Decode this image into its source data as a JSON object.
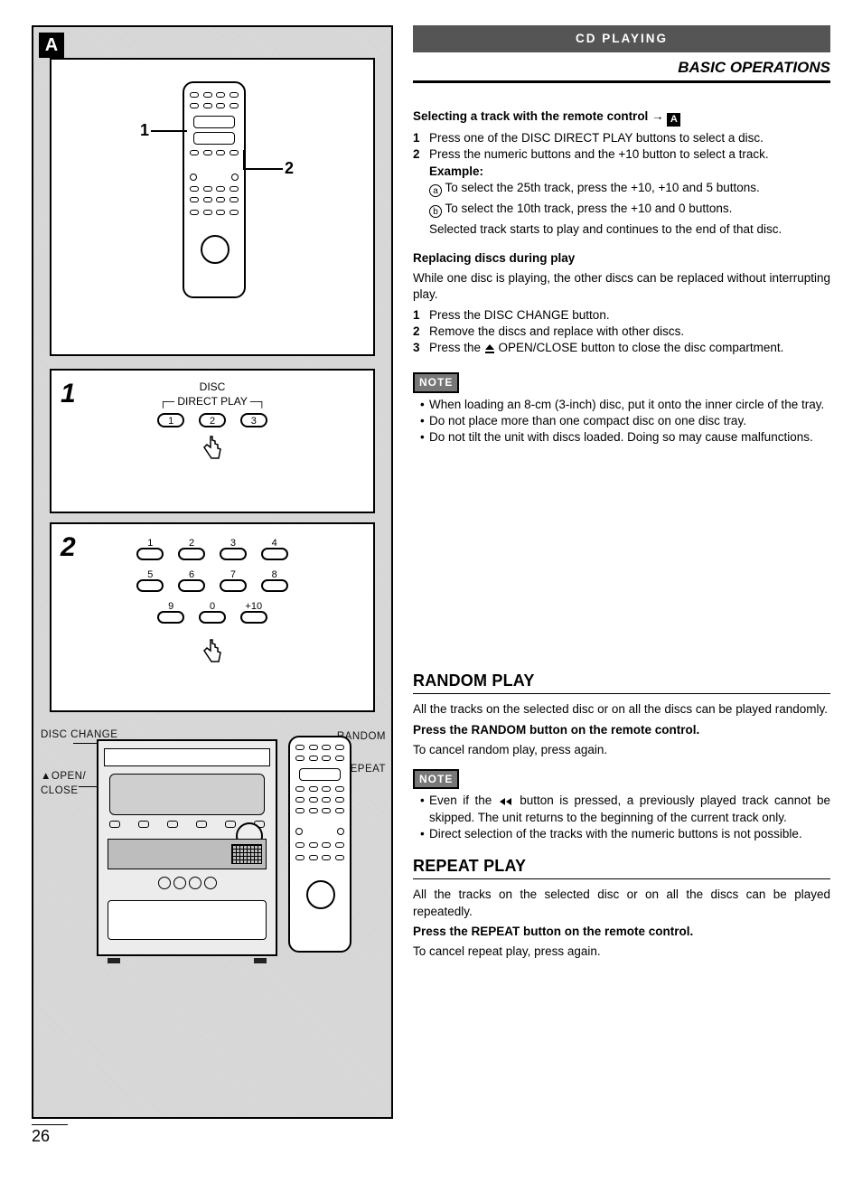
{
  "header": {
    "section": "CD PLAYING",
    "subsection": "BASIC OPERATIONS"
  },
  "figure": {
    "badge": "A",
    "panelA": {
      "callout1": "1",
      "callout2": "2"
    },
    "panel1": {
      "stepnum": "1",
      "caption_top": "DISC",
      "caption_bottom": "DIRECT PLAY",
      "buttons": [
        "1",
        "2",
        "3"
      ]
    },
    "panel2": {
      "stepnum": "2",
      "keys_row1": [
        "1",
        "2",
        "3",
        "4"
      ],
      "keys_row2": [
        "5",
        "6",
        "7",
        "8"
      ],
      "keys_row3": [
        "9",
        "0",
        "+10"
      ]
    },
    "panelB": {
      "labels": {
        "disc_change": "DISC CHANGE",
        "open_close_prefix": "▲OPEN/",
        "open_close_suffix": "CLOSE",
        "random": "RANDOM",
        "repeat": "REPEAT"
      }
    }
  },
  "right": {
    "s1": {
      "title": "Selecting a track with the remote control →",
      "ref": "A",
      "li1": "Press one of the DISC DIRECT PLAY buttons to select a disc.",
      "li2": "Press the numeric buttons and the +10 button to select a track.",
      "example_label": "Example:",
      "ex_a": "To select the 25th track, press the +10, +10 and 5 buttons.",
      "ex_b": "To select the 10th track, press the +10 and 0 buttons.",
      "after": "Selected track starts to play and continues to the end of that disc."
    },
    "s2": {
      "title": "Replacing discs during play",
      "intro": "While one disc is playing, the other discs can be replaced without interrupting play.",
      "li1": "Press the DISC CHANGE button.",
      "li2": "Remove the discs and replace with other discs.",
      "li3_a": "Press the ",
      "li3_b": " OPEN/CLOSE button to close the disc compartment."
    },
    "note1": {
      "label": "NOTE",
      "b1": "When loading an 8-cm (3-inch) disc, put it onto the inner circle of the tray.",
      "b2": "Do not place more than one compact disc on one disc tray.",
      "b3": "Do not tilt the unit with discs loaded.  Doing so may cause malfunctions."
    },
    "random": {
      "h": "RANDOM PLAY",
      "p1": "All the tracks on the selected disc or on all the discs can be played randomly.",
      "p2": "Press the RANDOM button on the remote control.",
      "p3": "To cancel random play, press again."
    },
    "note2": {
      "label": "NOTE",
      "b1a": "Even if the ",
      "b1b": " button is pressed, a previously played track cannot be skipped. The unit returns to the beginning of the current track only.",
      "b2": "Direct selection of the tracks with the numeric buttons is not possible."
    },
    "repeat": {
      "h": "REPEAT PLAY",
      "p1": "All the tracks on the selected disc or on all the discs can be played repeatedly.",
      "p2": "Press the REPEAT button on the remote control.",
      "p3": "To cancel repeat play, press again."
    }
  },
  "page_number": "26"
}
